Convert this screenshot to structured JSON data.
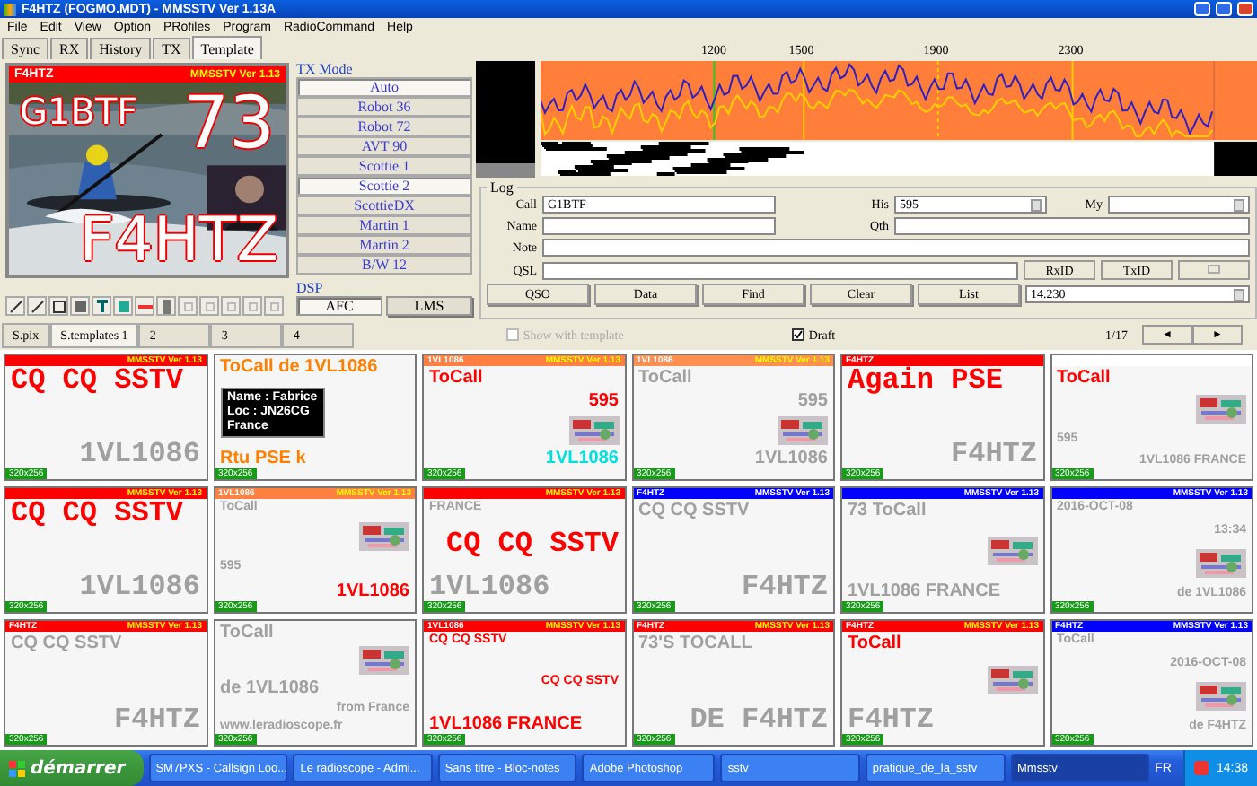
{
  "window": {
    "title": "F4HTZ (FOGMO.MDT) - MMSSTV Ver 1.13A"
  },
  "menu": [
    "File",
    "Edit",
    "View",
    "Option",
    "PRofiles",
    "Program",
    "RadioCommand",
    "Help"
  ],
  "tabs": [
    {
      "label": "Sync",
      "selected": false
    },
    {
      "label": "RX",
      "selected": false
    },
    {
      "label": "History",
      "selected": false
    },
    {
      "label": "TX",
      "selected": false
    },
    {
      "label": "Template",
      "selected": true
    }
  ],
  "preview": {
    "header_left": "F4HTZ",
    "header_right": "MMSSTV Ver 1.13",
    "to_call": "G1BTF",
    "report": "73",
    "my_call": "F4HTZ"
  },
  "tx_mode": {
    "title": "TX Mode",
    "modes": [
      {
        "label": "Auto",
        "selected": true
      },
      {
        "label": "Robot 36",
        "selected": false
      },
      {
        "label": "Robot 72",
        "selected": false
      },
      {
        "label": "AVT 90",
        "selected": false
      },
      {
        "label": "Scottie 1",
        "selected": false
      },
      {
        "label": "Scottie 2",
        "selected": true
      },
      {
        "label": "ScottieDX",
        "selected": false
      },
      {
        "label": "Martin 1",
        "selected": false
      },
      {
        "label": "Martin 2",
        "selected": false
      },
      {
        "label": "B/W 12",
        "selected": false
      }
    ]
  },
  "dsp": {
    "title": "DSP",
    "buttons": [
      {
        "label": "AFC",
        "selected": true
      },
      {
        "label": "LMS",
        "selected": false
      }
    ]
  },
  "spectrum": {
    "ticks": [
      "1200",
      "1500",
      "1900",
      "2300"
    ]
  },
  "log": {
    "title": "Log",
    "call": {
      "label": "Call",
      "value": "G1BTF"
    },
    "his": {
      "label": "His",
      "value": "595"
    },
    "my": {
      "label": "My"
    },
    "name": {
      "label": "Name"
    },
    "qth": {
      "label": "Qth"
    },
    "note": {
      "label": "Note"
    },
    "qsl": {
      "label": "QSL"
    },
    "id_buttons": [
      "RxID",
      "TxID"
    ],
    "actions": [
      "QSO",
      "Data",
      "Find",
      "Clear",
      "List"
    ],
    "frequency": "14.230"
  },
  "strip": {
    "tabs": [
      {
        "label": "S.pix",
        "selected": false
      },
      {
        "label": "S.templates 1",
        "selected": true
      },
      {
        "label": "2",
        "selected": false
      },
      {
        "label": "3",
        "selected": false
      },
      {
        "label": "4",
        "selected": false
      }
    ],
    "show_with_template": {
      "label": "Show with template",
      "checked": false,
      "disabled": true
    },
    "draft": {
      "label": "Draft",
      "checked": true
    },
    "page": "1/17",
    "prev": "◄",
    "next": "►"
  },
  "templates": [
    {
      "header": {
        "color": "#ff0000",
        "right": "MMSSTV Ver 1.13"
      },
      "items": [
        {
          "kind": "large",
          "text": "CQ CQ SSTV",
          "color": "#ff0000"
        },
        {
          "kind": "large",
          "text": "1VL1086",
          "color": "#a0a0a0"
        }
      ],
      "size_tag": "320x256"
    },
    {
      "items": [
        {
          "kind": "medium",
          "text": "ToCall de 1VL1086",
          "color": "#ff8000"
        },
        {
          "kind": "box",
          "lines": [
            "Name : Fabrice",
            "Loc : JN26CG",
            "France"
          ]
        },
        {
          "kind": "medium",
          "text": "Rtu PSE k",
          "color": "#ff8000"
        }
      ],
      "size_tag": "320x256"
    },
    {
      "header": {
        "color": "#ff8040",
        "left": "1VL1086",
        "right": "MMSSTV Ver 1.13"
      },
      "items": [
        {
          "kind": "medium",
          "text": "ToCall",
          "color": "#ff0000"
        },
        {
          "kind": "medium",
          "text": "595",
          "color": "#ff0000"
        },
        {
          "kind": "picture"
        },
        {
          "kind": "medium",
          "text": "1VL1086",
          "color": "#00e0e0"
        }
      ],
      "size_tag": "320x256"
    },
    {
      "header": {
        "color": "#ff9050",
        "left": "1VL1086",
        "right": "MMSSTV Ver 1.13"
      },
      "items": [
        {
          "kind": "medium",
          "text": "ToCall",
          "color": "#a0a0a0"
        },
        {
          "kind": "medium",
          "text": "595",
          "color": "#a0a0a0"
        },
        {
          "kind": "picture"
        },
        {
          "kind": "medium",
          "text": "1VL1086",
          "color": "#a0a0a0"
        }
      ],
      "size_tag": "320x256"
    },
    {
      "header": {
        "color": "#ff0000",
        "left": "F4HTZ"
      },
      "items": [
        {
          "kind": "large",
          "text": "Again PSE",
          "color": "#ff0000"
        },
        {
          "kind": "large",
          "text": "F4HTZ",
          "color": "#a0a0a0"
        }
      ],
      "size_tag": "320x256"
    },
    {
      "header": {
        "color": "#ffffff"
      },
      "items": [
        {
          "kind": "medium",
          "text": "ToCall",
          "color": "#ff0000"
        },
        {
          "kind": "picture"
        },
        {
          "kind": "small",
          "text": "595",
          "color": "#a0a0a0"
        },
        {
          "kind": "small",
          "text": "1VL1086 FRANCE",
          "color": "#a0a0a0"
        }
      ],
      "size_tag": "320x256"
    },
    {
      "header": {
        "color": "#ff0000",
        "right": "MMSSTV Ver 1.13"
      },
      "items": [
        {
          "kind": "large",
          "text": "CQ CQ SSTV",
          "color": "#ff0000"
        },
        {
          "kind": "large",
          "text": "1VL1086",
          "color": "#a0a0a0"
        }
      ],
      "size_tag": "320x256"
    },
    {
      "header": {
        "color": "#ff8040",
        "left": "1VL1086",
        "right": "MMSSTV Ver 1.13"
      },
      "items": [
        {
          "kind": "small",
          "text": "ToCall",
          "color": "#a0a0a0"
        },
        {
          "kind": "picture"
        },
        {
          "kind": "small",
          "text": "595",
          "color": "#a0a0a0"
        },
        {
          "kind": "medium",
          "text": "1VL1086",
          "color": "#ff0000"
        }
      ],
      "size_tag": "320x256"
    },
    {
      "header": {
        "color": "#ff0000",
        "right": "MMSSTV Ver 1.13"
      },
      "items": [
        {
          "kind": "small",
          "text": "FRANCE",
          "color": "#a0a0a0"
        },
        {
          "kind": "large",
          "text": "CQ CQ SSTV",
          "color": "#ff0000"
        },
        {
          "kind": "large",
          "text": "1VL1086",
          "color": "#a0a0a0"
        }
      ],
      "size_tag": "320x256"
    },
    {
      "header": {
        "color": "#0000ff",
        "left": "F4HTZ",
        "right": "MMSSTV Ver 1.13"
      },
      "items": [
        {
          "kind": "medium",
          "text": "CQ CQ SSTV",
          "color": "#a0a0a0"
        },
        {
          "kind": "large",
          "text": "F4HTZ",
          "color": "#a0a0a0"
        }
      ],
      "size_tag": "320x256"
    },
    {
      "header": {
        "color": "#0000ff",
        "right": "MMSSTV Ver 1.13"
      },
      "items": [
        {
          "kind": "medium",
          "text": "73 ToCall",
          "color": "#a0a0a0"
        },
        {
          "kind": "picture"
        },
        {
          "kind": "medium",
          "text": "1VL1086 FRANCE",
          "color": "#a0a0a0"
        }
      ],
      "size_tag": "320x256"
    },
    {
      "header": {
        "color": "#0000ff",
        "right": "MMSSTV Ver 1.13"
      },
      "items": [
        {
          "kind": "small",
          "text": "2016-OCT-08",
          "color": "#a0a0a0"
        },
        {
          "kind": "small",
          "text": "13:34",
          "color": "#a0a0a0"
        },
        {
          "kind": "picture"
        },
        {
          "kind": "small",
          "text": "de 1VL1086",
          "color": "#a0a0a0"
        }
      ],
      "size_tag": "320x256"
    },
    {
      "header": {
        "color": "#ff0000",
        "left": "F4HTZ",
        "right": "MMSSTV Ver 1.13"
      },
      "items": [
        {
          "kind": "medium",
          "text": "CQ CQ SSTV",
          "color": "#a0a0a0"
        },
        {
          "kind": "large",
          "text": "F4HTZ",
          "color": "#a0a0a0"
        }
      ],
      "size_tag": "320x256"
    },
    {
      "items": [
        {
          "kind": "medium",
          "text": "ToCall",
          "color": "#a0a0a0"
        },
        {
          "kind": "picture"
        },
        {
          "kind": "medium",
          "text": "de 1VL1086",
          "color": "#a0a0a0"
        },
        {
          "kind": "small",
          "text": "from France",
          "color": "#a0a0a0"
        },
        {
          "kind": "small",
          "text": "www.leradioscope.fr",
          "color": "#a0a0a0"
        }
      ],
      "size_tag": "320x256"
    },
    {
      "header": {
        "color": "#ff0000",
        "left": "1VL1086",
        "right": "MMSSTV Ver 1.13"
      },
      "items": [
        {
          "kind": "small",
          "text": "CQ CQ SSTV",
          "color": "#ff0000"
        },
        {
          "kind": "small",
          "text": "CQ CQ SSTV",
          "color": "#ff0000"
        },
        {
          "kind": "medium",
          "text": "1VL1086 FRANCE",
          "color": "#ff0000"
        }
      ],
      "size_tag": "320x256"
    },
    {
      "header": {
        "color": "#ff0000",
        "left": "F4HTZ",
        "right": "MMSSTV Ver 1.13"
      },
      "items": [
        {
          "kind": "medium",
          "text": "73'S TOCALL",
          "color": "#a0a0a0"
        },
        {
          "kind": "large",
          "text": "DE F4HTZ",
          "color": "#a0a0a0"
        }
      ],
      "size_tag": "320x256"
    },
    {
      "header": {
        "color": "#ff0000",
        "left": "F4HTZ",
        "right": "MMSSTV Ver 1.13"
      },
      "items": [
        {
          "kind": "medium",
          "text": "ToCall",
          "color": "#ff0000"
        },
        {
          "kind": "picture"
        },
        {
          "kind": "large",
          "text": "F4HTZ",
          "color": "#a0a0a0"
        }
      ],
      "size_tag": "320x256"
    },
    {
      "header": {
        "color": "#0000ff",
        "left": "F4HTZ",
        "right": "MMSSTV Ver 1.13"
      },
      "items": [
        {
          "kind": "small",
          "text": "ToCall",
          "color": "#a0a0a0"
        },
        {
          "kind": "small",
          "text": "2016-OCT-08",
          "color": "#a0a0a0"
        },
        {
          "kind": "picture"
        },
        {
          "kind": "small",
          "text": "de F4HTZ",
          "color": "#a0a0a0"
        }
      ],
      "size_tag": "320x256"
    }
  ],
  "taskbar": {
    "start": "démarrer",
    "items": [
      {
        "label": "SM7PXS - Callsign Loo...",
        "selected": false
      },
      {
        "label": "Le radioscope - Admi...",
        "selected": false
      },
      {
        "label": "Sans titre - Bloc-notes",
        "selected": false
      },
      {
        "label": "Adobe Photoshop",
        "selected": false
      },
      {
        "label": "sstv",
        "selected": false
      },
      {
        "label": "pratique_de_la_sstv",
        "selected": false
      },
      {
        "label": "Mmsstv",
        "selected": true
      }
    ],
    "language": "FR",
    "clock": "14:38"
  }
}
